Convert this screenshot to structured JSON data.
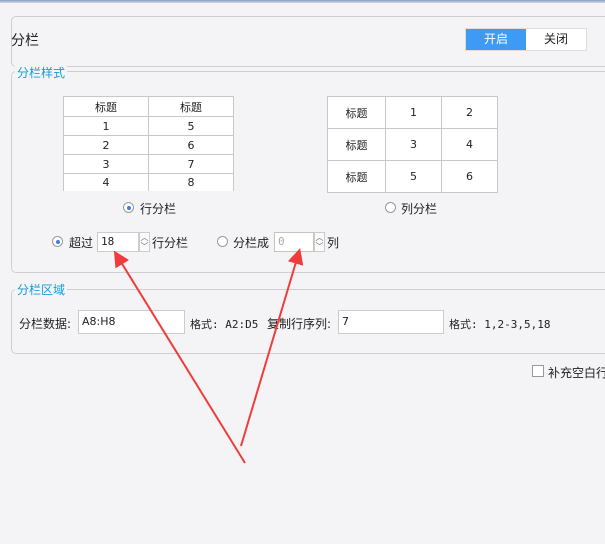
{
  "header": {
    "title": "分栏",
    "on_label": "开启",
    "off_label": "关闭",
    "active": "on",
    "accent": "#3d9af5"
  },
  "style_section": {
    "legend": "分栏样式",
    "row_table": {
      "headers": [
        "标题",
        "标题"
      ],
      "rows": [
        [
          "1",
          "5"
        ],
        [
          "2",
          "6"
        ],
        [
          "3",
          "7"
        ],
        [
          "4",
          "8"
        ]
      ]
    },
    "col_table": {
      "rows": [
        [
          "标题",
          "1",
          "2"
        ],
        [
          "标题",
          "3",
          "4"
        ],
        [
          "标题",
          "5",
          "6"
        ]
      ]
    },
    "row_mode_label": "行分栏",
    "col_mode_label": "列分栏",
    "selected_mode": "row",
    "exceed_label": "超过",
    "exceed_value": "18",
    "exceed_suffix": "行分栏",
    "split_into_label": "分栏成",
    "split_into_value": "0",
    "split_into_suffix": "列"
  },
  "area_section": {
    "legend": "分栏区域",
    "data_label": "分栏数据:",
    "data_value": "A8:H8",
    "data_format": "格式: A2:D5",
    "copy_label": "复制行序列:",
    "copy_value": "7",
    "copy_format": "格式: 1,2-3,5,18"
  },
  "fill_blank_label": "补充空白行",
  "fill_blank_checked": false,
  "annotation_color": "#f03c3c"
}
